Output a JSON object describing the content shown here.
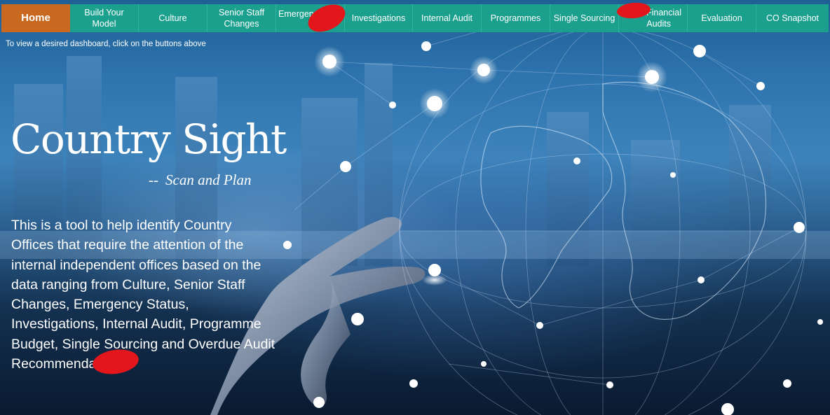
{
  "nav": {
    "items": [
      {
        "label": "Home",
        "key": "home"
      },
      {
        "label": "Build Your Model",
        "key": "build-your-model"
      },
      {
        "label": "Culture",
        "key": "culture"
      },
      {
        "label": "Senior Staff Changes",
        "line1": "Senior Staff",
        "line2": "Changes",
        "key": "senior-staff-changes"
      },
      {
        "label": "Emergen",
        "key": "emergency"
      },
      {
        "label": "Investigations",
        "key": "investigations"
      },
      {
        "label": "Internal Audit",
        "key": "internal-audit"
      },
      {
        "label": "Programmes",
        "key": "programmes"
      },
      {
        "label": "Single Sourcing",
        "key": "single-sourcing"
      },
      {
        "label": "Financial Audits",
        "line1": "Financial",
        "line2": "Audits",
        "key": "financial-audits"
      },
      {
        "label": "Evaluation",
        "key": "evaluation"
      },
      {
        "label": "CO Snapshot",
        "key": "co-snapshot"
      }
    ],
    "home_color": "#c8691f",
    "bar_color": "#1ba08e"
  },
  "hint": "To view a desired dashboard, click on the buttons above",
  "hero": {
    "title": "Country Sight",
    "subtitle_dash": "--",
    "subtitle": "Scan and Plan",
    "description": "This is a tool to help identify Country Offices that require the attention of the internal independent offices based on the data ranging from Culture, Senior Staff Changes, Emergency Status, Investigations, Internal Audit, Programme Budget, Single Sourcing and Overdue Audit Recommendations"
  },
  "redaction_color": "#e3161c"
}
